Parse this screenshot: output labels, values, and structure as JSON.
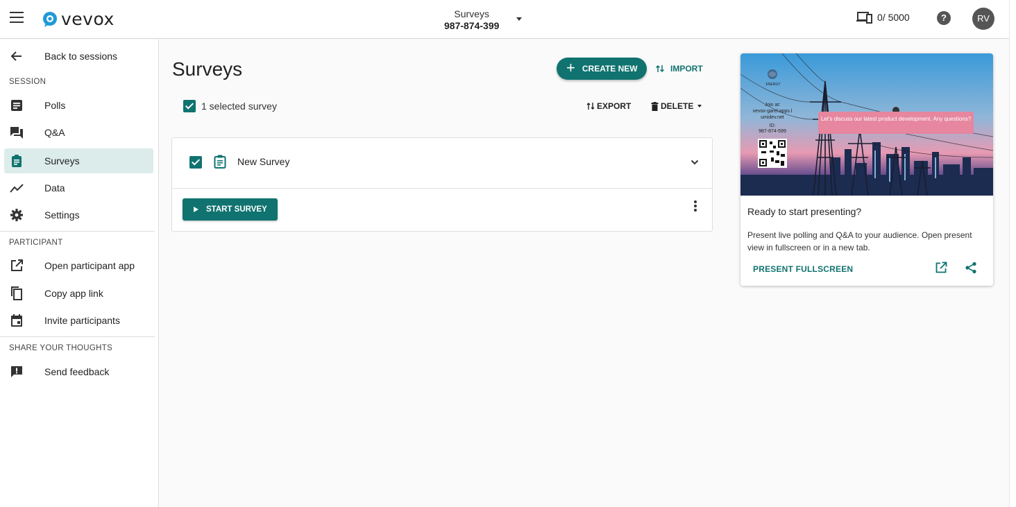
{
  "header": {
    "logo_text": "vevox",
    "session_title": "Surveys",
    "session_id": "987-874-399",
    "participants": "0/ 5000",
    "help": "?",
    "avatar_initials": "RV"
  },
  "sidebar": {
    "back_label": "Back to sessions",
    "section_session": "SESSION",
    "session_items": [
      {
        "label": "Polls",
        "icon": "polls-icon"
      },
      {
        "label": "Q&A",
        "icon": "qa-icon"
      },
      {
        "label": "Surveys",
        "icon": "surveys-icon",
        "active": true
      },
      {
        "label": "Data",
        "icon": "data-icon"
      },
      {
        "label": "Settings",
        "icon": "gear-icon"
      }
    ],
    "section_participant": "PARTICIPANT",
    "participant_items": [
      {
        "label": "Open participant app",
        "icon": "open-external-icon"
      },
      {
        "label": "Copy app link",
        "icon": "copy-icon"
      },
      {
        "label": "Invite participants",
        "icon": "calendar-icon"
      }
    ],
    "section_share": "SHARE YOUR THOUGHTS",
    "share_items": [
      {
        "label": "Send feedback",
        "icon": "feedback-icon"
      }
    ]
  },
  "main": {
    "title": "Surveys",
    "create_new": "CREATE NEW",
    "import": "IMPORT",
    "selected_text": "1 selected survey",
    "export": "EXPORT",
    "delete": "DELETE",
    "surveys": [
      {
        "name": "New Survey",
        "checked": true
      }
    ],
    "start_survey": "START SURVEY"
  },
  "present_card": {
    "preview": {
      "brand": "ENERGY",
      "join_at": "Join at:",
      "join_url": "vevox-garel.apps.l umidev.net",
      "id_label": "ID:",
      "id_value": "987-874-599",
      "bubble": "Let's discuss our latest product development. Any questions?"
    },
    "title": "Ready to start presenting?",
    "description": "Present live polling and Q&A to your audience. Open present view in fullscreen or in a new tab.",
    "present_fullscreen": "PRESENT FULLSCREEN"
  },
  "colors": {
    "accent": "#10736f",
    "active_bg": "#dcecea",
    "bubble": "#e6869f"
  }
}
